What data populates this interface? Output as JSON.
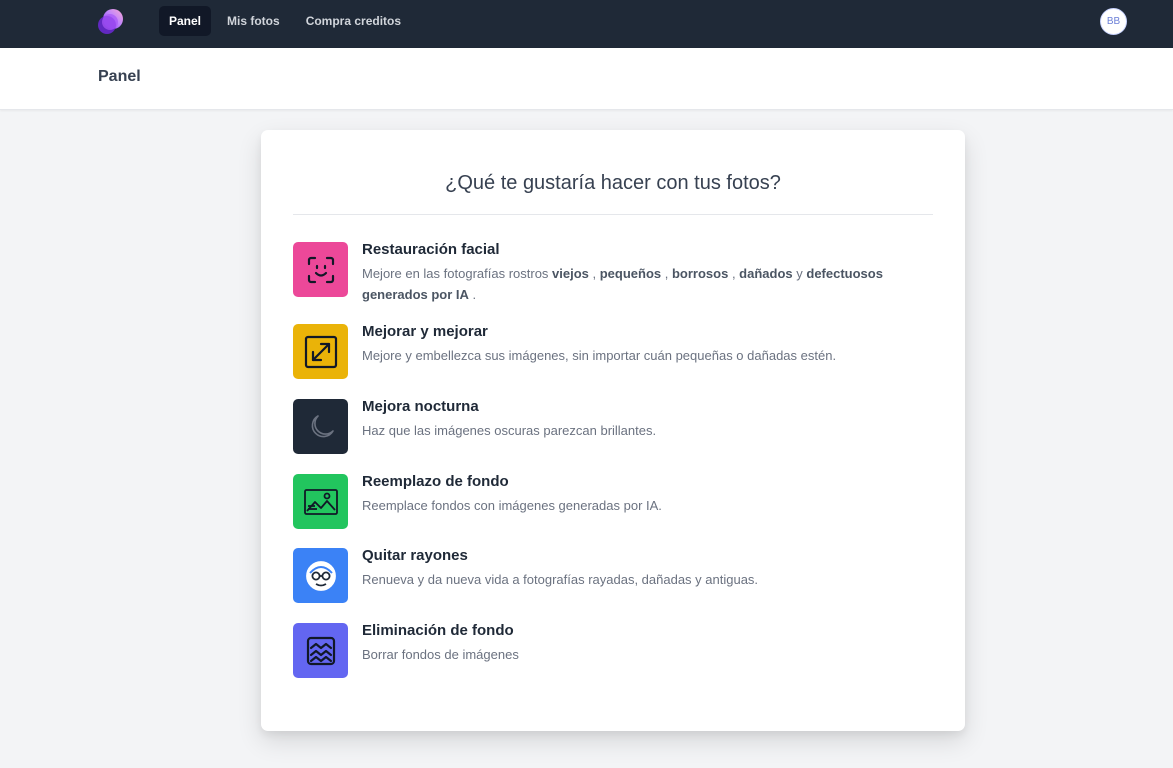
{
  "nav": {
    "items": [
      {
        "label": "Panel",
        "active": true
      },
      {
        "label": "Mis fotos",
        "active": false
      },
      {
        "label": "Compra creditos",
        "active": false
      }
    ],
    "avatar_initials": "BB"
  },
  "header": {
    "title": "Panel"
  },
  "card": {
    "title": "¿Qué te gustaría hacer con tus fotos?",
    "options": [
      {
        "title": "Restauración facial",
        "desc_parts": [
          "Mejore en las fotografías rostros ",
          "viejos",
          " , ",
          "pequeños",
          " , ",
          "borrosos",
          " , ",
          "dañados",
          " y ",
          "defectuosos generados por IA",
          " ."
        ],
        "icon": "face-scan-icon",
        "color": "#ec4899"
      },
      {
        "title": "Mejorar y mejorar",
        "desc": "Mejore y embellezca sus imágenes, sin importar cuán pequeñas o dañadas estén.",
        "icon": "expand-arrows-icon",
        "color": "#eab308"
      },
      {
        "title": "Mejora nocturna",
        "desc": "Haz que las imágenes oscuras parezcan brillantes.",
        "icon": "moon-icon",
        "color": "#1f2937"
      },
      {
        "title": "Reemplazo de fondo",
        "desc": "Reemplace fondos con imágenes generadas por IA.",
        "icon": "landscape-image-icon",
        "color": "#22c55e"
      },
      {
        "title": "Quitar rayones",
        "desc": "Renueva y da nueva vida a fotografías rayadas, dañadas y antiguas.",
        "icon": "old-face-icon",
        "color": "#3b82f6"
      },
      {
        "title": "Eliminación de fondo",
        "desc": "Borrar fondos de imágenes",
        "icon": "waves-frame-icon",
        "color": "#6366f1"
      }
    ]
  }
}
